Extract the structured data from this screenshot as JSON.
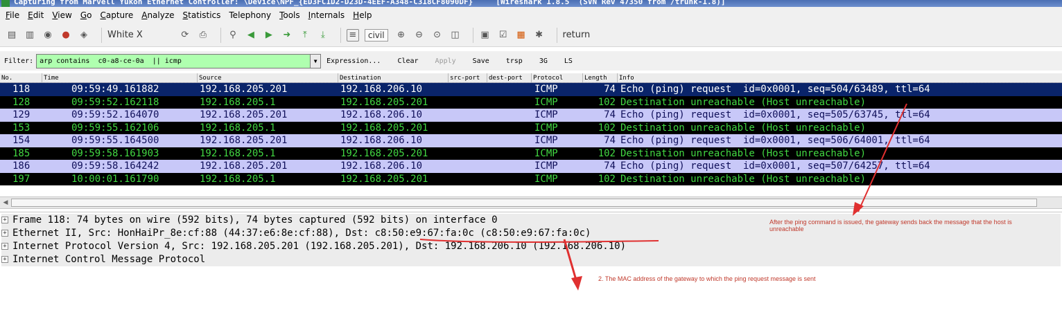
{
  "window": {
    "title": "Capturing from Marvell Yukon Ethernet Controller: \\Device\\NPF_{ED3FC1D2-D23D-4EEF-A348-C318CF8090DF}     [Wireshark 1.8.5  (SVN Rev 47350 from /trunk-1.8)]"
  },
  "menu": {
    "items": [
      {
        "label": "File",
        "u": "F",
        "rest": "ile"
      },
      {
        "label": "Edit",
        "u": "E",
        "rest": "dit"
      },
      {
        "label": "View",
        "u": "V",
        "rest": "iew"
      },
      {
        "label": "Go",
        "u": "G",
        "rest": "o"
      },
      {
        "label": "Capture",
        "u": "C",
        "rest": "apture"
      },
      {
        "label": "Analyze",
        "u": "A",
        "rest": "nalyze"
      },
      {
        "label": "Statistics",
        "u": "S",
        "rest": "tatistics"
      },
      {
        "label": "Telephony",
        "u": "",
        "rest": "Telephony"
      },
      {
        "label": "Tools",
        "u": "T",
        "rest": "ools"
      },
      {
        "label": "Internals",
        "u": "I",
        "rest": "nternals"
      },
      {
        "label": "Help",
        "u": "H",
        "rest": "elp"
      }
    ]
  },
  "toolbar": {
    "white_x": "White X",
    "civil": "civil",
    "return": "return"
  },
  "filter": {
    "label": "Filter:",
    "value": "arp contains  c0-a8-ce-0a  || icmp",
    "expression": "Expression...",
    "clear": "Clear",
    "apply": "Apply",
    "save": "Save",
    "btn_trsp": "trsp",
    "btn_3g": "3G",
    "btn_ls": "LS"
  },
  "columns": [
    "No.",
    "Time",
    "Source",
    "Destination",
    "src-port",
    "dest-port",
    "Protocol",
    "Length",
    "Info"
  ],
  "colors": {
    "selected_bg": "#0a246a",
    "selected_fg": "#ffffff",
    "request_bg": "#c8c8f8",
    "request_fg": "#10105a",
    "error_bg": "#000000",
    "error_fg": "#42d842",
    "annotation": "#c0392b"
  },
  "packets": [
    {
      "no": "118",
      "time": "09:59:49.161882",
      "src": "192.168.205.201",
      "dst": "192.168.206.10",
      "proto": "ICMP",
      "len": "74",
      "info": "Echo (ping) request  id=0x0001, seq=504/63489, ttl=64",
      "style": "selected"
    },
    {
      "no": "128",
      "time": "09:59:52.162118",
      "src": "192.168.205.1",
      "dst": "192.168.205.201",
      "proto": "ICMP",
      "len": "102",
      "info": "Destination unreachable (Host unreachable)",
      "style": "error"
    },
    {
      "no": "129",
      "time": "09:59:52.164070",
      "src": "192.168.205.201",
      "dst": "192.168.206.10",
      "proto": "ICMP",
      "len": "74",
      "info": "Echo (ping) request  id=0x0001, seq=505/63745, ttl=64",
      "style": "request"
    },
    {
      "no": "153",
      "time": "09:59:55.162106",
      "src": "192.168.205.1",
      "dst": "192.168.205.201",
      "proto": "ICMP",
      "len": "102",
      "info": "Destination unreachable (Host unreachable)",
      "style": "error"
    },
    {
      "no": "154",
      "time": "09:59:55.164500",
      "src": "192.168.205.201",
      "dst": "192.168.206.10",
      "proto": "ICMP",
      "len": "74",
      "info": "Echo (ping) request  id=0x0001, seq=506/64001, ttl=64",
      "style": "request"
    },
    {
      "no": "185",
      "time": "09:59:58.161903",
      "src": "192.168.205.1",
      "dst": "192.168.205.201",
      "proto": "ICMP",
      "len": "102",
      "info": "Destination unreachable (Host unreachable)",
      "style": "error"
    },
    {
      "no": "186",
      "time": "09:59:58.164242",
      "src": "192.168.205.201",
      "dst": "192.168.206.10",
      "proto": "ICMP",
      "len": "74",
      "info": "Echo (ping) request  id=0x0001, seq=507/64257, ttl=64",
      "style": "request"
    },
    {
      "no": "197",
      "time": "10:00:01.161790",
      "src": "192.168.205.1",
      "dst": "192.168.205.201",
      "proto": "ICMP",
      "len": "102",
      "info": "Destination unreachable (Host unreachable)",
      "style": "error"
    }
  ],
  "details": [
    {
      "expander": "+",
      "text": "Frame 118: 74 bytes on wire (592 bits), 74 bytes captured (592 bits) on interface 0"
    },
    {
      "expander": "+",
      "text": "Ethernet II, Src: HonHaiPr_8e:cf:88 (44:37:e6:8e:cf:88), Dst: c8:50:e9:67:fa:0c (c8:50:e9:67:fa:0c)"
    },
    {
      "expander": "+",
      "text": "Internet Protocol Version 4, Src: 192.168.205.201 (192.168.205.201), Dst: 192.168.206.10 (192.168.206.10)"
    },
    {
      "expander": "+",
      "text": "Internet Control Message Protocol"
    }
  ],
  "annotations": {
    "note1": "After the ping command is issued, the gateway sends back the message that the host is unreachable",
    "note2": "2. The MAC address of the gateway to which the ping request message is sent"
  }
}
